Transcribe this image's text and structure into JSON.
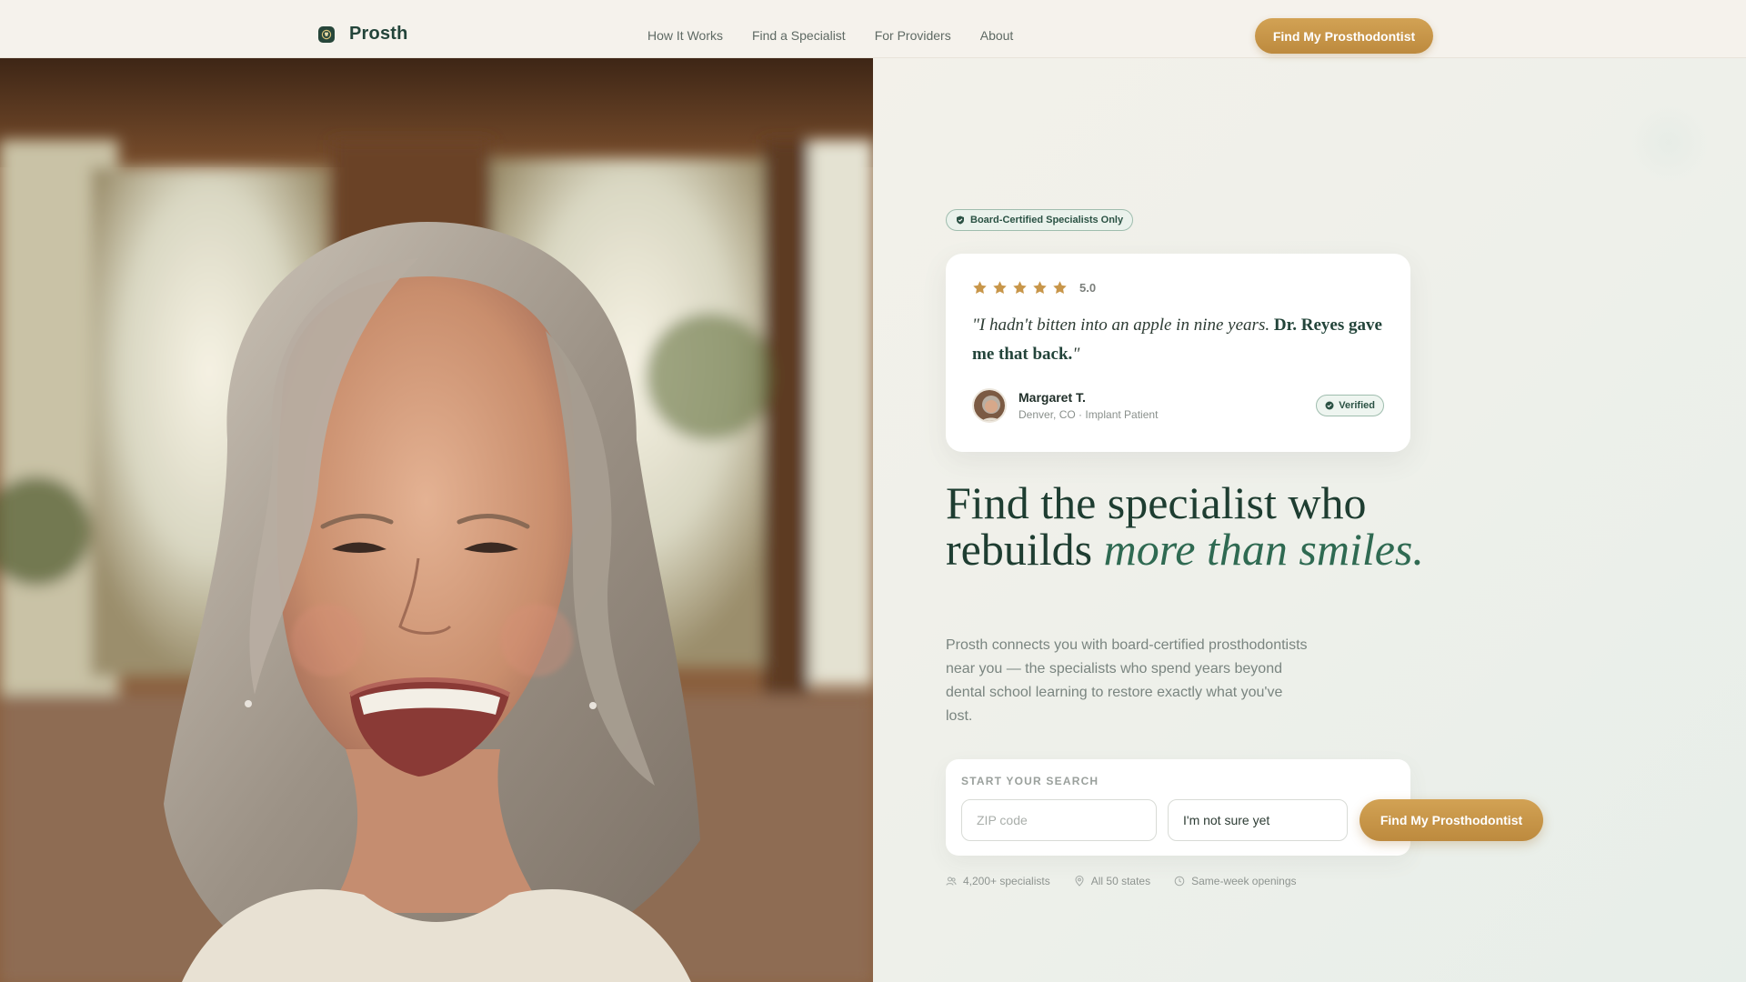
{
  "brand": {
    "name": "Prosth"
  },
  "nav": {
    "items": [
      "How It Works",
      "Find a Specialist",
      "For Providers",
      "About"
    ],
    "cta": "Find My Prosthodontist"
  },
  "hero": {
    "badge": "Board-Certified Specialists Only",
    "testimonial": {
      "rating": 5,
      "rating_label": "5.0",
      "quote_start": "\"I hadn't bitten into an apple in nine years.",
      "quote_bold": "Dr. Reyes gave me that back.",
      "quote_end": "\"",
      "author_name": "Margaret T.",
      "author_meta": "Denver, CO · Implant Patient",
      "verified": "Verified"
    },
    "headline_part1": "Find the specialist who rebuilds",
    "headline_accent": "more than smiles.",
    "subcopy": "Prosth connects you with board-certified prosthodontists near you — the specialists who spend years beyond dental school learning to restore exactly what you've lost."
  },
  "search": {
    "label": "START YOUR SEARCH",
    "zip_placeholder": "ZIP code",
    "zip_value": "",
    "select_value": "I'm not sure yet",
    "cta": "Find My Prosthodontist"
  },
  "stats": [
    {
      "icon": "users-icon",
      "label": "4,200+ specialists"
    },
    {
      "icon": "map-pin-icon",
      "label": "All 50 states"
    },
    {
      "icon": "clock-icon",
      "label": "Same-week openings"
    }
  ],
  "colors": {
    "primary_green": "#1e3d31",
    "accent_green": "#2f6a52",
    "gold": "#c8964a",
    "background": "#f4f3ee"
  }
}
